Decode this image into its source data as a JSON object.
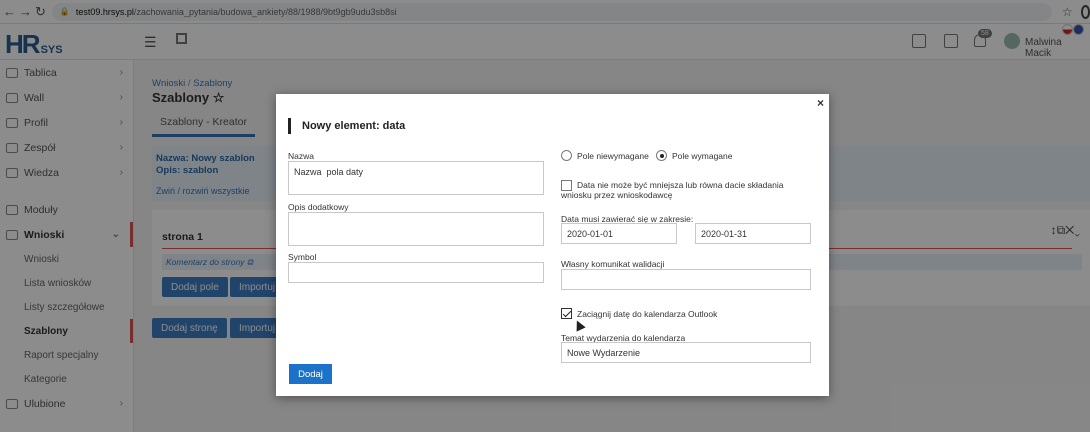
{
  "browser": {
    "url_host": "test09.hrsys.pl",
    "url_path": "/zachowania_pytania/budowa_ankiety/88/1988/9bt9gb9udu3sb8si"
  },
  "app": {
    "logo_main": "HR",
    "logo_suffix": "SYS",
    "notification_count": "58",
    "user_name": "Malwina Macik"
  },
  "sidebar": {
    "items": [
      {
        "label": "Tablica"
      },
      {
        "label": "Wall"
      },
      {
        "label": "Profil"
      },
      {
        "label": "Zespół"
      },
      {
        "label": "Wiedza"
      },
      {
        "label": "Moduły"
      },
      {
        "label": "Wnioski"
      },
      {
        "label": "Ulubione"
      }
    ],
    "subitems": [
      {
        "label": "Wnioski"
      },
      {
        "label": "Lista wniosków"
      },
      {
        "label": "Listy szczegółowe"
      },
      {
        "label": "Szablony"
      },
      {
        "label": "Raport specjalny"
      },
      {
        "label": "Kategorie"
      }
    ]
  },
  "content": {
    "breadcrumb_1": "Wnioski",
    "breadcrumb_sep": "/",
    "breadcrumb_2": "Szablony",
    "title": "Szablony",
    "tab_label": "Szablony - Kreator",
    "info_name": "Nazwa: Nowy szablon",
    "info_desc": "Opis: szablon",
    "collapse_label": "Zwiń / rozwiń wszystkie",
    "page_title": "strona 1",
    "comment_label": "Komentarz do strony",
    "add_field_button": "Dodaj pole",
    "import_button_1": "Importuj",
    "add_page_button": "Dodaj stronę",
    "import_button_2": "Importuj"
  },
  "modal": {
    "close_label": "×",
    "title": "Nowy element: data",
    "name_label": "Nazwa",
    "name_value": "Nazwa  pola daty",
    "description_label": "Opis dodatkowy",
    "description_value": "",
    "symbol_label": "Symbol",
    "symbol_value": "",
    "radio_optional": "Pole niewymagane",
    "radio_required": "Pole wymagane",
    "date_constraint_label": "Data nie może być mniejsza lub równa dacie składania wniosku przez wnioskodawcę",
    "date_range_label": "Data musi zawierać się w zakresie:",
    "date_from": "2020-01-01",
    "date_to": "2020-01-31",
    "validation_label": "Własny komunikat walidacji",
    "validation_value": "",
    "outlook_label": "Zaciągnij datę do kalendarza Outlook",
    "event_topic_label": "Temat wydarzenia do kalendarza",
    "event_topic_value": "Nowe Wydarzenie",
    "add_button": "Dodaj"
  }
}
